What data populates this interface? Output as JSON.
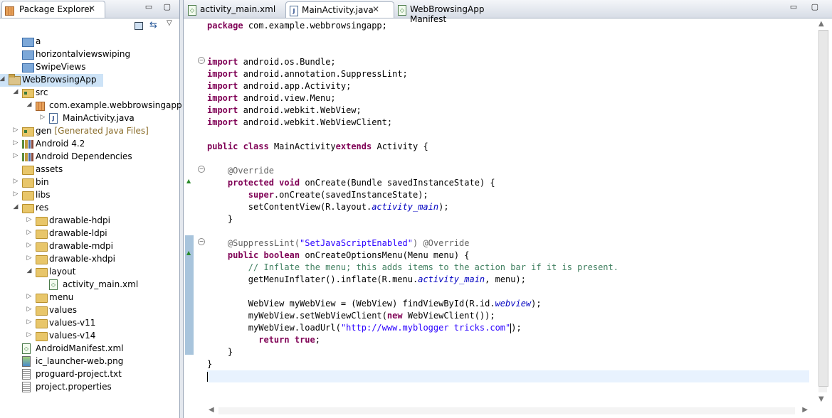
{
  "package_explorer": {
    "tab_label": "Package Explorer",
    "close_glyph": "✕",
    "minmax_glyphs": "▭ ▢",
    "toolbar": {
      "link_glyph": "⇆",
      "menu_glyph": "▽"
    },
    "tree": [
      {
        "label": "a",
        "icon": "blue-folder-icon"
      },
      {
        "label": "horizontalviewswiping",
        "icon": "blue-folder-icon"
      },
      {
        "label": "SwipeViews",
        "icon": "blue-folder-icon"
      },
      {
        "label": "WebBrowsingApp",
        "icon": "project-icon",
        "twisty": "◢",
        "selected": true
      },
      {
        "label": "src",
        "icon": "source-folder-icon",
        "twisty": "◢"
      },
      {
        "label": "com.example.webbrowsingapp",
        "icon": "package-icon",
        "twisty": "◢"
      },
      {
        "label": "MainActivity.java",
        "icon": "java-file-icon",
        "twisty": "▷"
      },
      {
        "label": "gen",
        "decoration": "[Generated Java Files]",
        "icon": "source-folder-icon",
        "twisty": "▷"
      },
      {
        "label": "Android 4.2",
        "icon": "library-icon",
        "twisty": "▷"
      },
      {
        "label": "Android Dependencies",
        "icon": "library-icon",
        "twisty": "▷"
      },
      {
        "label": "assets",
        "icon": "folder-icon"
      },
      {
        "label": "bin",
        "icon": "folder-icon",
        "twisty": "▷"
      },
      {
        "label": "libs",
        "icon": "folder-icon",
        "twisty": "▷"
      },
      {
        "label": "res",
        "icon": "folder-icon",
        "twisty": "◢"
      },
      {
        "label": "drawable-hdpi",
        "icon": "folder-icon",
        "twisty": "▷"
      },
      {
        "label": "drawable-ldpi",
        "icon": "folder-icon",
        "twisty": "▷"
      },
      {
        "label": "drawable-mdpi",
        "icon": "folder-icon",
        "twisty": "▷"
      },
      {
        "label": "drawable-xhdpi",
        "icon": "folder-icon",
        "twisty": "▷"
      },
      {
        "label": "layout",
        "icon": "folder-icon",
        "twisty": "◢"
      },
      {
        "label": "activity_main.xml",
        "icon": "xml-file-icon"
      },
      {
        "label": "menu",
        "icon": "folder-icon",
        "twisty": "▷"
      },
      {
        "label": "values",
        "icon": "folder-icon",
        "twisty": "▷"
      },
      {
        "label": "values-v11",
        "icon": "folder-icon",
        "twisty": "▷"
      },
      {
        "label": "values-v14",
        "icon": "folder-icon",
        "twisty": "▷"
      },
      {
        "label": "AndroidManifest.xml",
        "icon": "xml-file-icon"
      },
      {
        "label": "ic_launcher-web.png",
        "icon": "image-file-icon"
      },
      {
        "label": "proguard-project.txt",
        "icon": "text-file-icon"
      },
      {
        "label": "project.properties",
        "icon": "text-file-icon"
      }
    ]
  },
  "editor": {
    "tabs": [
      {
        "label": "activity_main.xml",
        "icon": "xml-file-icon"
      },
      {
        "label": "MainActivity.java",
        "icon": "java-file-icon",
        "active": true,
        "close": "✕"
      },
      {
        "label": "WebBrowsingApp Manifest",
        "icon": "manifest-icon"
      }
    ],
    "minmax_glyphs": "▭ ▢",
    "lines": [
      [
        [
          "kw",
          "package"
        ],
        [
          "",
          "com.example.webbrowsingapp;"
        ]
      ],
      [],
      [],
      [
        [
          "kw",
          "import"
        ],
        [
          "",
          "android.os.Bundle;"
        ]
      ],
      [
        [
          "kw",
          "import"
        ],
        [
          "",
          "android.annotation.SuppressLint;"
        ]
      ],
      [
        [
          "kw",
          "import"
        ],
        [
          "",
          "android.app.Activity;"
        ]
      ],
      [
        [
          "kw",
          "import"
        ],
        [
          "",
          "android.view.Menu;"
        ]
      ],
      [
        [
          "kw",
          "import"
        ],
        [
          "",
          "android.webkit.WebView;"
        ]
      ],
      [
        [
          "kw",
          "import"
        ],
        [
          "",
          "android.webkit.WebViewClient;"
        ]
      ],
      [],
      [
        [
          "kw",
          "public"
        ],
        [
          "kw",
          "class"
        ],
        [
          "",
          "MainActivity"
        ],
        [
          "kw",
          "extends"
        ],
        [
          "",
          "Activity {"
        ]
      ],
      [],
      [
        [
          "an",
          "    @Override"
        ]
      ],
      [
        [
          "",
          "    "
        ],
        [
          "kw",
          "protected"
        ],
        [
          "kw",
          "void"
        ],
        [
          "",
          "onCreate(Bundle savedInstanceState) {"
        ]
      ],
      [
        [
          "",
          "        "
        ],
        [
          "kw",
          "super"
        ],
        [
          "",
          ".onCreate(savedInstanceState);"
        ]
      ],
      [
        [
          "",
          "        setContentView(R.layout."
        ],
        [
          "fld",
          "activity_main"
        ],
        [
          "",
          ");"
        ]
      ],
      [
        [
          "",
          "    }"
        ]
      ],
      [],
      [
        [
          "an",
          "    @SuppressLint("
        ],
        [
          "str",
          "\"SetJavaScriptEnabled\""
        ],
        [
          "an",
          ") @Override"
        ]
      ],
      [
        [
          "",
          "    "
        ],
        [
          "kw",
          "public"
        ],
        [
          "kw",
          "boolean"
        ],
        [
          "",
          "onCreateOptionsMenu(Menu menu) {"
        ]
      ],
      [
        [
          "cm",
          "        // Inflate the menu; this adds items to the action bar if it is present."
        ]
      ],
      [
        [
          "",
          "        getMenuInflater().inflate(R.menu."
        ],
        [
          "fld",
          "activity_main"
        ],
        [
          "",
          ", menu);"
        ]
      ],
      [],
      [
        [
          "",
          "        WebView myWebView = (WebView) findViewById(R.id."
        ],
        [
          "fld",
          "webview"
        ],
        [
          "",
          ");"
        ]
      ],
      [
        [
          "",
          "        myWebView.setWebViewClient("
        ],
        [
          "kw",
          "new"
        ],
        [
          "",
          "WebViewClient());"
        ]
      ],
      [
        [
          "",
          "        myWebView.loadUrl("
        ],
        [
          "str",
          "\"http://www.myblogger tricks.com\""
        ],
        [
          "caret",
          ""
        ],
        [
          "",
          ");"
        ]
      ],
      [
        [
          "",
          "          "
        ],
        [
          "kw",
          "return"
        ],
        [
          "kw",
          "true"
        ],
        [
          "",
          ";"
        ]
      ],
      [
        [
          "",
          "    }"
        ]
      ],
      [
        [
          "",
          "}"
        ]
      ],
      []
    ],
    "current_line": 29
  }
}
